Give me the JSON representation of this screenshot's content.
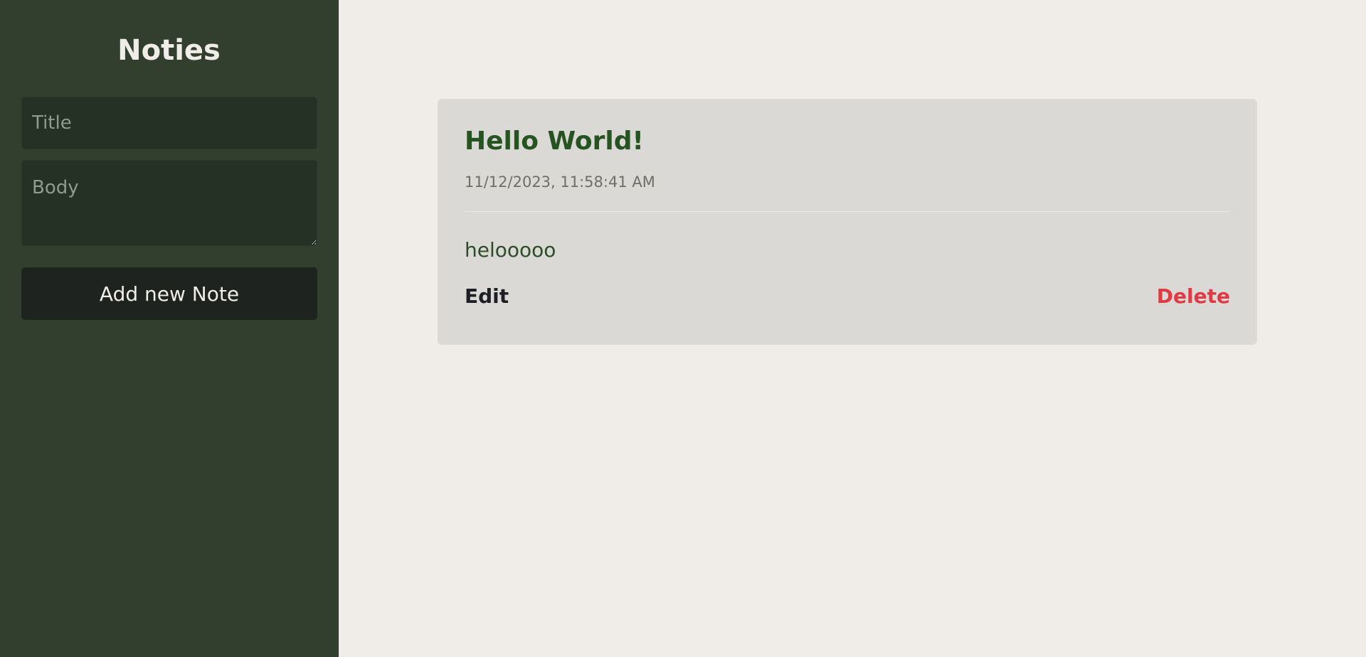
{
  "app": {
    "title": "Noties"
  },
  "sidebar": {
    "title_placeholder": "Title",
    "body_placeholder": "Body",
    "add_button_label": "Add new Note"
  },
  "notes": [
    {
      "title": "Hello World!",
      "timestamp": "11/12/2023, 11:58:41 AM",
      "body": "helooooo",
      "edit_label": "Edit",
      "delete_label": "Delete"
    }
  ],
  "colors": {
    "sidebar_bg": "#323f2e",
    "main_bg": "#f0ede8",
    "card_bg": "#dbd9d5",
    "note_title": "#265420",
    "delete": "#e03a44"
  }
}
